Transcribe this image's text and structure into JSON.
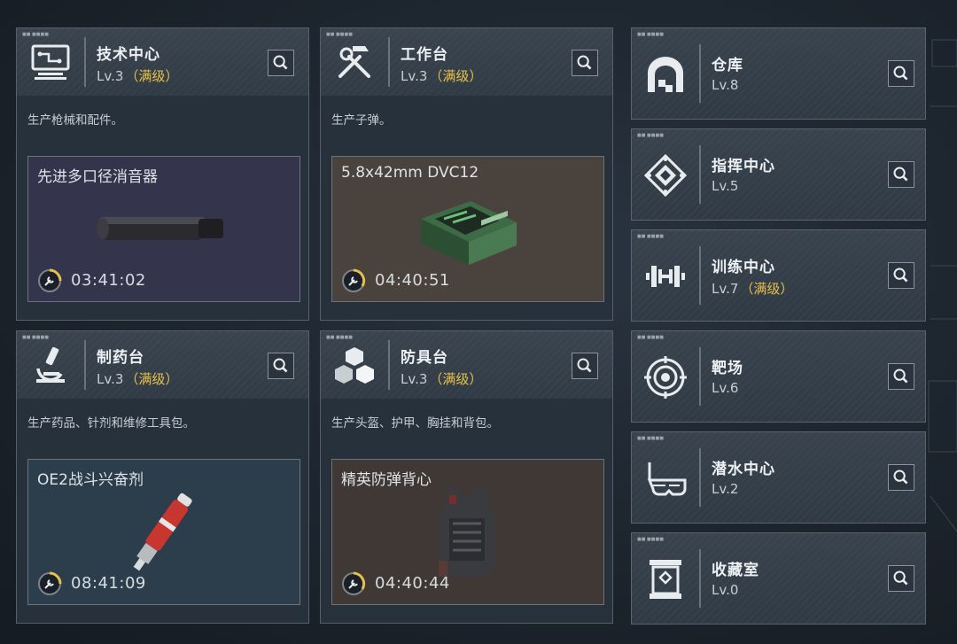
{
  "workshops": [
    {
      "name": "技术中心",
      "level": "Lv.3",
      "max": "（满级）",
      "description": "生产枪械和配件。",
      "crafting": {
        "item": "先进多口径消音器",
        "timer": "03:41:02"
      },
      "icon": "computer-icon"
    },
    {
      "name": "工作台",
      "level": "Lv.3",
      "max": "（满级）",
      "description": "生产子弹。",
      "crafting": {
        "item": "5.8x42mm DVC12",
        "timer": "04:40:51"
      },
      "icon": "hammer-wrench-icon"
    },
    {
      "name": "制药台",
      "level": "Lv.3",
      "max": "（满级）",
      "description": "生产药品、针剂和维修工具包。",
      "crafting": {
        "item": "OE2战斗兴奋剂",
        "timer": "08:41:09"
      },
      "icon": "microscope-icon"
    },
    {
      "name": "防具台",
      "level": "Lv.3",
      "max": "（满级）",
      "description": "生产头盔、护甲、胸挂和背包。",
      "crafting": {
        "item": "精英防弹背心",
        "timer": "04:40:44"
      },
      "icon": "blocks-icon"
    }
  ],
  "facilities": [
    {
      "name": "仓库",
      "level": "Lv.8",
      "max": "",
      "icon": "warehouse-icon"
    },
    {
      "name": "指挥中心",
      "level": "Lv.5",
      "max": "",
      "icon": "command-emblem-icon"
    },
    {
      "name": "训练中心",
      "level": "Lv.7",
      "max": "（满级）",
      "icon": "dumbbell-icon"
    },
    {
      "name": "靶场",
      "level": "Lv.6",
      "max": "",
      "icon": "target-icon"
    },
    {
      "name": "潜水中心",
      "level": "Lv.2",
      "max": "",
      "icon": "diving-mask-icon"
    },
    {
      "name": "收藏室",
      "level": "Lv.0",
      "max": "",
      "icon": "display-case-icon"
    }
  ],
  "colors": {
    "max_level": "#e6c04a",
    "card_bg": "#26313b",
    "header_bg": "#363f49"
  }
}
